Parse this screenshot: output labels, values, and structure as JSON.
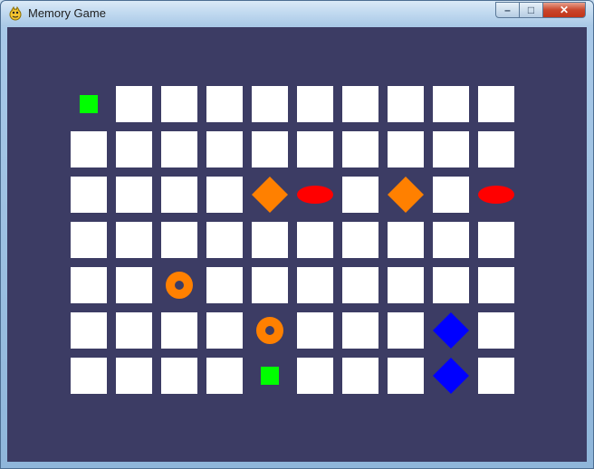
{
  "window": {
    "title": "Memory Game",
    "minimize_label": "–",
    "maximize_label": "□",
    "close_label": "✕"
  },
  "board": {
    "background_color": "#3c3c64",
    "tile_color": "#ffffff",
    "columns": 10,
    "rows": 7,
    "revealed": [
      {
        "row": 0,
        "col": 0,
        "shape": "square",
        "color": "#00ff00"
      },
      {
        "row": 2,
        "col": 4,
        "shape": "diamond",
        "color": "#ff8000"
      },
      {
        "row": 2,
        "col": 5,
        "shape": "oval",
        "color": "#ff0000"
      },
      {
        "row": 2,
        "col": 7,
        "shape": "diamond",
        "color": "#ff8000"
      },
      {
        "row": 2,
        "col": 9,
        "shape": "oval",
        "color": "#ff0000"
      },
      {
        "row": 4,
        "col": 2,
        "shape": "donut",
        "color": "#ff8000"
      },
      {
        "row": 5,
        "col": 4,
        "shape": "donut",
        "color": "#ff8000"
      },
      {
        "row": 5,
        "col": 8,
        "shape": "diamond",
        "color": "#0000ff"
      },
      {
        "row": 6,
        "col": 4,
        "shape": "square",
        "color": "#00ff00"
      },
      {
        "row": 6,
        "col": 8,
        "shape": "diamond",
        "color": "#0000ff"
      }
    ]
  }
}
